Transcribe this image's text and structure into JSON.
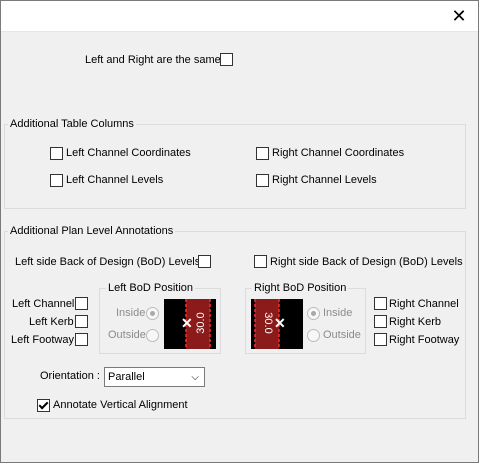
{
  "window": {
    "close_icon": "✕"
  },
  "same": {
    "label": "Left and Right are the same",
    "checked": false
  },
  "table_columns": {
    "title": "Additional Table Columns",
    "left_coords": "Left Channel Coordinates",
    "right_coords": "Right Channel Coordinates",
    "left_levels": "Left Channel Levels",
    "right_levels": "Right Channel Levels"
  },
  "annotations": {
    "title": "Additional Plan Level Annotations",
    "left_bod": "Left side Back of Design (BoD) Levels",
    "right_bod": "Right side Back of Design (BoD) Levels",
    "left_channel": "Left Channel",
    "left_kerb": "Left Kerb",
    "left_footway": "Left Footway",
    "right_channel": "Right Channel",
    "right_kerb": "Right Kerb",
    "right_footway": "Right Footway",
    "left_pos": {
      "title": "Left BoD Position",
      "inside": "Inside",
      "outside": "Outside",
      "preview_value": "30.0"
    },
    "right_pos": {
      "title": "Right BoD Position",
      "inside": "Inside",
      "outside": "Outside",
      "preview_value": "30.0"
    },
    "orientation_label": "Orientation :",
    "orientation_value": "Parallel",
    "annotate_vertical": "Annotate Vertical Alignment",
    "annotate_vertical_checked": true
  },
  "colors": {
    "preview_bg": "#000000",
    "preview_band": "#8b1a1a",
    "preview_line": "#ff2a2a"
  }
}
